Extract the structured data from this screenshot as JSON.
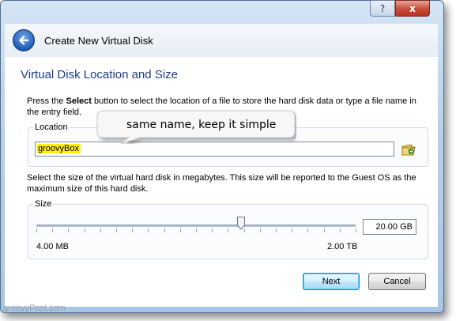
{
  "window": {
    "help_glyph": "?",
    "close_glyph": "x"
  },
  "header": {
    "title": "Create New Virtual Disk"
  },
  "page": {
    "title": "Virtual Disk Location and Size",
    "instruction_prefix": "Press the ",
    "instruction_bold": "Select",
    "instruction_suffix": " button to select the location of a file to store the hard disk data or type a file name in the entry field."
  },
  "location": {
    "label": "Location",
    "value": "groovyBox"
  },
  "size": {
    "description": "Select the size of the virtual hard disk in megabytes. This size will be reported to the Guest OS as the maximum size of this hard disk.",
    "label": "Size",
    "value": "20.00 GB",
    "min_label": "4.00 MB",
    "max_label": "2.00 TB",
    "slider_fraction": 0.64
  },
  "buttons": {
    "next": "Next",
    "cancel": "Cancel"
  },
  "callout": {
    "text": "same name, keep it simple"
  },
  "watermark": "groovyPost.com",
  "colors": {
    "title_blue": "#1e3c8c",
    "highlight_yellow": "#fff200"
  }
}
